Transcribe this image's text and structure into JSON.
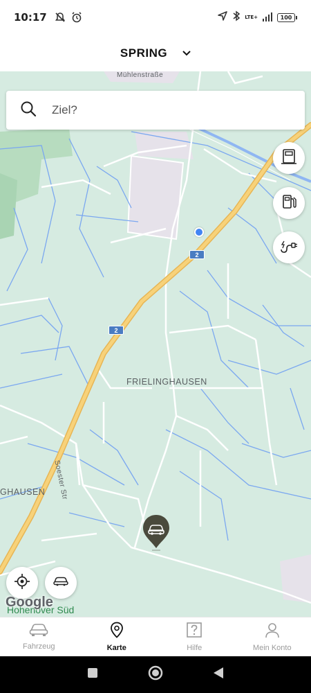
{
  "status_bar": {
    "time": "10:17",
    "network": "LTE+",
    "battery": "100"
  },
  "header": {
    "title": "SPRING"
  },
  "search": {
    "placeholder": "Ziel?"
  },
  "map": {
    "labels": {
      "street_top": "Mühlenstraße",
      "place_center": "FRIELINGHAUSEN",
      "place_left": "GHAUSEN",
      "street_vertical": "Soester Str",
      "place_bottom": "Hohenover Süd"
    },
    "road_shield": "2",
    "attribution": "Google"
  },
  "map_buttons": [
    {
      "icon": "charging-station-icon"
    },
    {
      "icon": "fuel-pump-icon"
    },
    {
      "icon": "charging-cable-icon"
    }
  ],
  "bottom_nav": {
    "items": [
      {
        "label": "Fahrzeug",
        "icon": "car-icon"
      },
      {
        "label": "Karte",
        "icon": "map-pin-icon",
        "active": true
      },
      {
        "label": "Hilfe",
        "icon": "help-icon"
      },
      {
        "label": "Mein Konto",
        "icon": "person-icon"
      }
    ]
  },
  "colors": {
    "map_background": "#d6ebe1",
    "highway": "#f5c563",
    "water": "#7aa7f0",
    "marker": "#4a4a3c",
    "user_dot": "#4285f4"
  }
}
